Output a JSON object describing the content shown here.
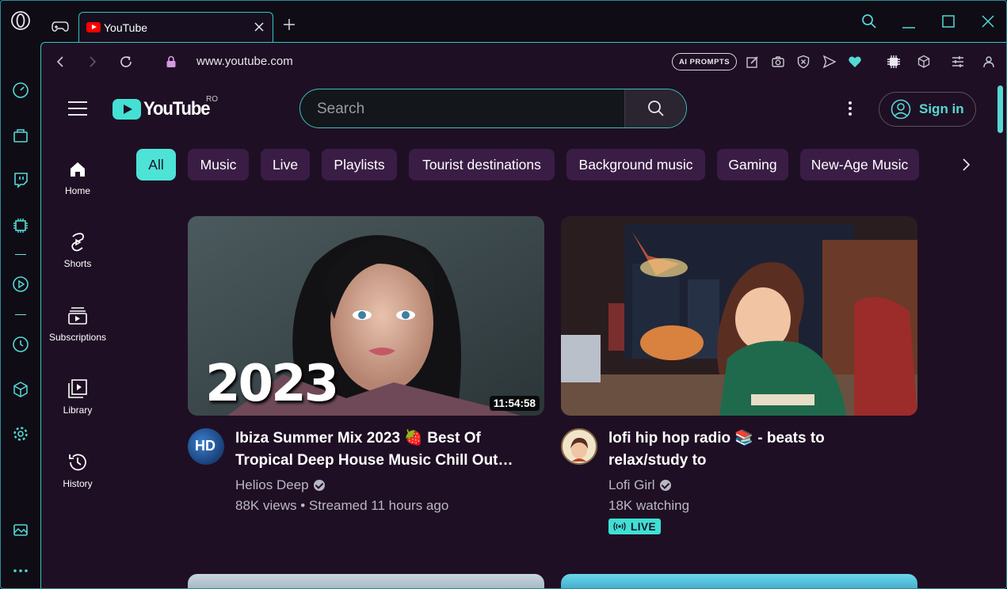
{
  "browser": {
    "accent": "#55d9d3",
    "tab": {
      "title": "YouTube"
    },
    "address": {
      "url": "www.youtube.com",
      "ai_button": "AI PROMPTS"
    }
  },
  "youtube": {
    "logo_text": "YouTube",
    "country_code": "RO",
    "search_placeholder": "Search",
    "sign_in": "Sign in",
    "nav": [
      {
        "label": "Home",
        "icon": "home-icon"
      },
      {
        "label": "Shorts",
        "icon": "shorts-icon"
      },
      {
        "label": "Subscriptions",
        "icon": "subscriptions-icon"
      },
      {
        "label": "Library",
        "icon": "library-icon"
      },
      {
        "label": "History",
        "icon": "history-icon"
      }
    ],
    "chips": [
      "All",
      "Music",
      "Live",
      "Playlists",
      "Tourist destinations",
      "Background music",
      "Gaming",
      "New-Age Music"
    ],
    "videos": [
      {
        "title": "Ibiza Summer Mix 2023 🍓 Best Of Tropical Deep House Music Chill Out…",
        "thumb_text": "2023",
        "duration": "11:54:58",
        "channel": "Helios Deep",
        "avatar_text": "HD",
        "meta": "88K views • Streamed 11 hours ago"
      },
      {
        "title": "lofi hip hop radio 📚 - beats to relax/study to",
        "channel": "Lofi Girl",
        "meta": "18K watching",
        "badge": "LIVE"
      }
    ]
  }
}
